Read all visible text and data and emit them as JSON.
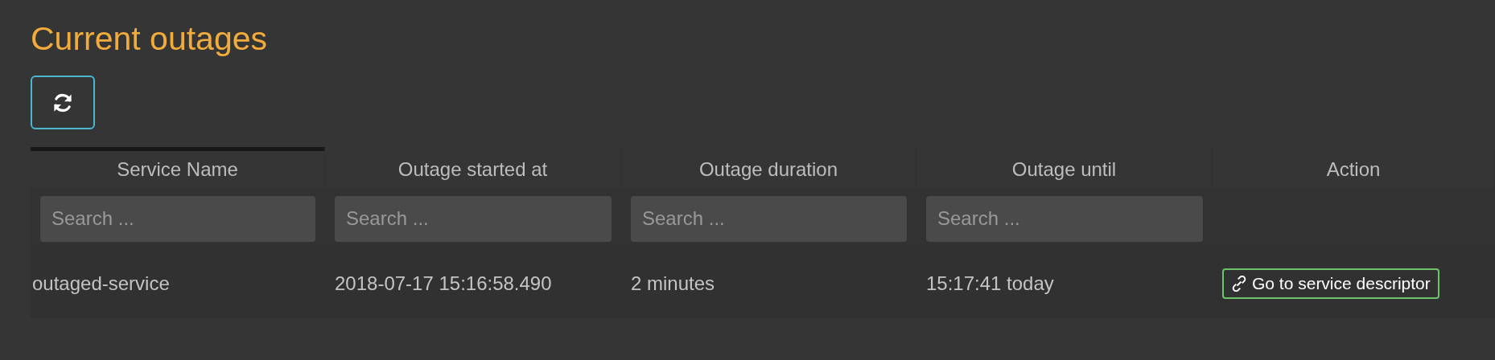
{
  "title": "Current outages",
  "refresh_button": {
    "focused": true
  },
  "table": {
    "columns": [
      {
        "label": "Service Name",
        "sorted": true,
        "search": {
          "placeholder": "Search ..."
        }
      },
      {
        "label": "Outage started at",
        "sorted": false,
        "search": {
          "placeholder": "Search ..."
        }
      },
      {
        "label": "Outage duration",
        "sorted": false,
        "search": {
          "placeholder": "Search ..."
        }
      },
      {
        "label": "Outage until",
        "sorted": false,
        "search": {
          "placeholder": "Search ..."
        }
      },
      {
        "label": "Action",
        "sorted": false
      }
    ],
    "rows": [
      {
        "cells": [
          {
            "kind": "text",
            "text": "outaged-service"
          },
          {
            "kind": "text",
            "text": "2018-07-17 15:16:58.490"
          },
          {
            "kind": "text",
            "text": "2 minutes"
          },
          {
            "kind": "text",
            "text": "15:17:41 today"
          },
          {
            "kind": "link_button",
            "text": "Go to service descriptor"
          }
        ]
      }
    ]
  }
}
